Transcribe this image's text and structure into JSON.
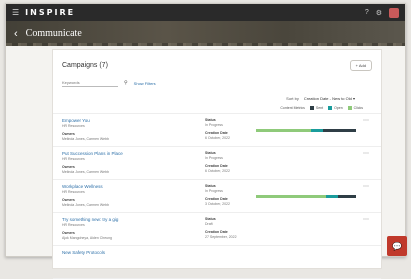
{
  "app": {
    "brand": "INSPIRE",
    "page_title": "Communicate"
  },
  "icons": {
    "menu": "hamburger-icon",
    "back": "back-arrow-icon",
    "search": "search-icon",
    "help": "help-icon",
    "settings": "gear-icon",
    "chat": "chat-icon"
  },
  "card": {
    "title": "Campaigns (7)",
    "add_label": "+ Add",
    "keyword_placeholder": "Keywords",
    "show_filters": "Show Filters",
    "sort_label": "Sort by",
    "sort_value": "Creation Date - New to Old",
    "legend": {
      "title": "Content Metrics",
      "items": [
        "Sent",
        "Open",
        "Clicks"
      ]
    }
  },
  "colors": {
    "sent": "#2f3e46",
    "open": "#1a9c9c",
    "clicks": "#8fca7a",
    "link": "#2c6fa8",
    "brand_red": "#c0392b"
  },
  "labels": {
    "owners": "Owners",
    "status": "Status",
    "creation_date": "Creation Date"
  },
  "campaigns": [
    {
      "name": "Empower You",
      "type": "HR Resources",
      "status": "In Progress",
      "owners": "Melinda Jones, Carmen Webb",
      "date": "6 October, 2022",
      "bar": {
        "clicks": 0.55,
        "open": 0.12,
        "sent": 0.33
      }
    },
    {
      "name": "Put Succession Plans in Place",
      "type": "HR Resources",
      "status": "In Progress",
      "owners": "Melinda Jones, Carmen Webb",
      "date": "6 October, 2022",
      "bar": null
    },
    {
      "name": "Workplace Wellness",
      "type": "HR Resources",
      "status": "In Progress",
      "owners": "Melinda Jones, Carmen Webb",
      "date": "3 October, 2022",
      "bar": {
        "clicks": 0.7,
        "open": 0.12,
        "sent": 0.18
      }
    },
    {
      "name": "Try something new: try a gig",
      "type": "HR Resources",
      "status": "Draft",
      "owners": "Ajok Mangoheya, Aiden Cheung",
      "date": "27 September, 2022",
      "bar": null
    },
    {
      "name": "New Safety Protocols",
      "type": "",
      "status": "",
      "owners": "",
      "date": "",
      "bar": null
    }
  ]
}
